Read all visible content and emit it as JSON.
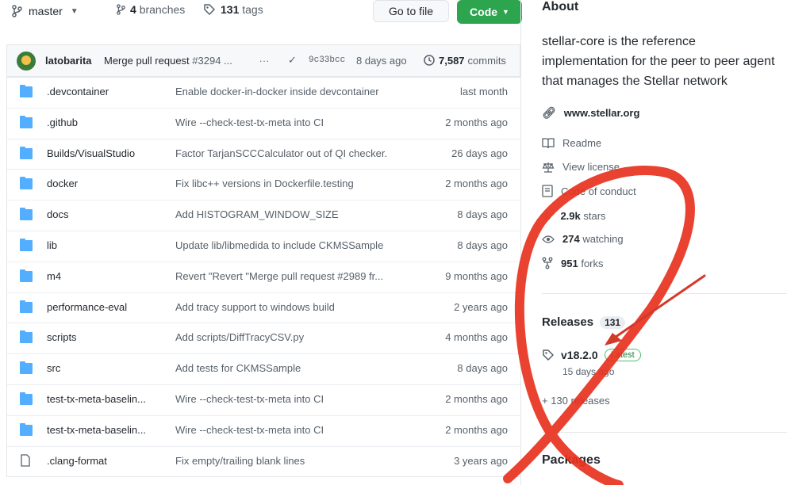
{
  "topbar": {
    "branch": "master",
    "branches_count": "4",
    "branches_label": "branches",
    "tags_count": "131",
    "tags_label": "tags",
    "goto_label": "Go to file",
    "code_label": "Code"
  },
  "commit": {
    "author": "latobarita",
    "message_prefix": "Merge pull request ",
    "message_link": "#3294 ...",
    "sha": "9c33bcc",
    "time": "8 days ago",
    "count": "7,587",
    "count_label": "commits"
  },
  "files": [
    {
      "type": "dir",
      "name": ".devcontainer",
      "message": "Enable docker-in-docker inside devcontainer",
      "age": "last month"
    },
    {
      "type": "dir",
      "name": ".github",
      "message": "Wire --check-test-tx-meta into CI",
      "age": "2 months ago"
    },
    {
      "type": "dir",
      "name": "Builds/VisualStudio",
      "message": "Factor TarjanSCCCalculator out of QI checker.",
      "age": "26 days ago"
    },
    {
      "type": "dir",
      "name": "docker",
      "message": "Fix libc++ versions in Dockerfile.testing",
      "age": "2 months ago"
    },
    {
      "type": "dir",
      "name": "docs",
      "message": "Add HISTOGRAM_WINDOW_SIZE",
      "age": "8 days ago"
    },
    {
      "type": "dir",
      "name": "lib",
      "message": "Update lib/libmedida to include CKMSSample",
      "age": "8 days ago"
    },
    {
      "type": "dir",
      "name": "m4",
      "message": "Revert \"Revert \"Merge pull request #2989 fr...",
      "age": "9 months ago"
    },
    {
      "type": "dir",
      "name": "performance-eval",
      "message": "Add tracy support to windows build",
      "age": "2 years ago"
    },
    {
      "type": "dir",
      "name": "scripts",
      "message": "Add scripts/DiffTracyCSV.py",
      "age": "4 months ago"
    },
    {
      "type": "dir",
      "name": "src",
      "message": "Add tests for CKMSSample",
      "age": "8 days ago"
    },
    {
      "type": "dir",
      "name": "test-tx-meta-baselin...",
      "message": "Wire --check-test-tx-meta into CI",
      "age": "2 months ago"
    },
    {
      "type": "dir",
      "name": "test-tx-meta-baselin...",
      "message": "Wire --check-test-tx-meta into CI",
      "age": "2 months ago"
    },
    {
      "type": "file",
      "name": ".clang-format",
      "message": "Fix empty/trailing blank lines",
      "age": "3 years ago"
    }
  ],
  "about": {
    "title": "About",
    "description": "stellar-core is the reference implementation for the peer to peer agent that manages the Stellar network",
    "website": "www.stellar.org",
    "readme": "Readme",
    "license": "View license",
    "conduct": "Code of conduct",
    "stars_count": "2.9k",
    "stars_label": "stars",
    "watching_count": "274",
    "watching_label": "watching",
    "forks_count": "951",
    "forks_label": "forks"
  },
  "releases": {
    "title": "Releases",
    "count": "131",
    "latest_tag": "v18.2.0",
    "latest_badge": "Latest",
    "latest_date": "15 days ago",
    "more": "+ 130 releases"
  },
  "packages": {
    "title": "Packages"
  },
  "colors": {
    "code_button": "#2da44e",
    "folder": "#54aeff",
    "annotation": "#e8321e"
  },
  "icons": [
    "branch-icon",
    "tag-icon",
    "history-icon",
    "check-icon",
    "folder-icon",
    "file-icon",
    "link-icon",
    "book-icon",
    "scale-icon",
    "code-of-conduct-icon",
    "star-icon",
    "eye-icon",
    "fork-icon"
  ]
}
